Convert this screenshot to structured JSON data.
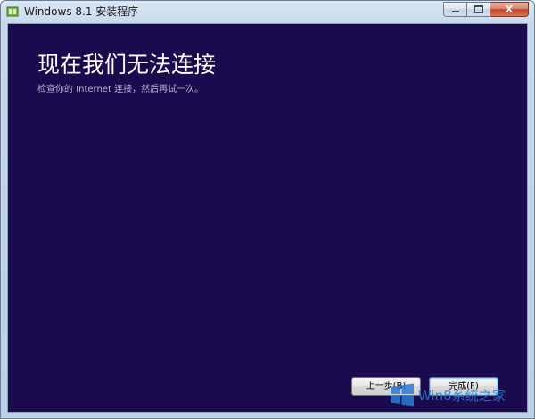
{
  "window": {
    "title": "Windows 8.1 安装程序"
  },
  "titlebar": {
    "close_glyph": "X"
  },
  "content": {
    "heading": "现在我们无法连接",
    "subtext": "检查你的 Internet 连接，然后再试一次。"
  },
  "buttons": {
    "back_label": "上一步(B)",
    "finish_label": "完成(F)"
  },
  "watermark": {
    "text": "Win8系统之家"
  },
  "colors": {
    "background": "#1c0a4e",
    "accent": "#2c7bd6"
  },
  "icons": {
    "app": "setup-icon",
    "minimize": "minimize-icon",
    "maximize": "maximize-icon",
    "close": "close-icon",
    "watermark": "windows-logo-icon"
  }
}
